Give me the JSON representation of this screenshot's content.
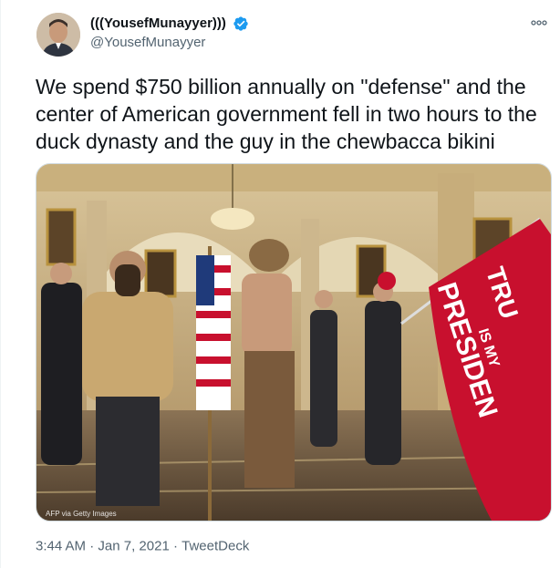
{
  "tweet": {
    "display_name": "(((YousefMunayyer)))",
    "handle": "@YousefMunayyer",
    "verified": true,
    "verified_icon": "verified-badge-icon",
    "more_icon": "more-options-icon",
    "text": "We spend $750 billion annually on \"defense\" and the center of American government fell in two hours to the duck dynasty and the guy in the chewbacca bikini",
    "media": {
      "credit": "AFP via Getty Images",
      "flag_text_lines": [
        "TRU",
        "IS MY",
        "PRESIDEN"
      ]
    },
    "time": "3:44 AM",
    "separator": "·",
    "date": "Jan 7, 2021",
    "source": "TweetDeck"
  },
  "colors": {
    "verified": "#1d9bf0",
    "secondary_text": "#536471",
    "flag_red": "#c8102e"
  }
}
